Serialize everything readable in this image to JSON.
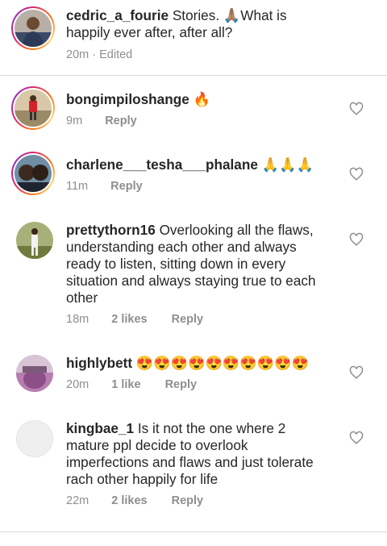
{
  "caption": {
    "username": "cedric_a_fourie",
    "text": "Stories. 🙏🏽What is happily ever after, after all?",
    "time": "20m",
    "sep": "·",
    "edited": "Edited"
  },
  "comments": [
    {
      "username": "bongimpiloshange",
      "text": "🔥",
      "time": "9m",
      "likes": "",
      "reply": "Reply"
    },
    {
      "username": "charlene___tesha___phalane",
      "text": "🙏🙏🙏",
      "time": "11m",
      "likes": "",
      "reply": "Reply"
    },
    {
      "username": "prettythorn16",
      "text": "Overlooking all the flaws, understanding each other and always ready to listen, sitting down in every situation and always staying true to each other",
      "time": "18m",
      "likes": "2 likes",
      "reply": "Reply"
    },
    {
      "username": "highlybett",
      "text": "😍😍😍😍😍😍😍😍😍😍",
      "time": "20m",
      "likes": "1 like",
      "reply": "Reply"
    },
    {
      "username": "kingbae_1",
      "text": "Is it not the one where 2 mature ppl decide to overlook imperfections and flaws and just tolerate rach other happily for life",
      "time": "22m",
      "likes": "2 likes",
      "reply": "Reply"
    }
  ],
  "icons": {
    "like": "heart-outline-icon"
  },
  "colors": {
    "meta": "#8e8e8e",
    "divider": "#dbdbdb",
    "ring": "#d62976"
  }
}
